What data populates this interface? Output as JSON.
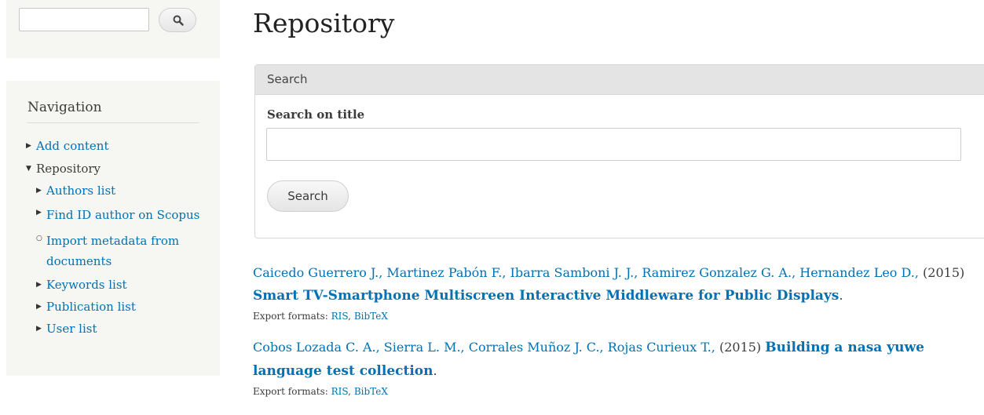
{
  "sidebar": {
    "search": {
      "value": "",
      "button_icon": "search-icon"
    },
    "navigation": {
      "title": "Navigation",
      "items": [
        {
          "label": "Add content",
          "state": "collapsed"
        },
        {
          "label": "Repository",
          "state": "expanded",
          "children": [
            {
              "label": "Authors list"
            },
            {
              "label": "Find ID author on Scopus"
            },
            {
              "label": "Import metadata from documents"
            },
            {
              "label": "Keywords list"
            },
            {
              "label": "Publication list"
            },
            {
              "label": "User list"
            }
          ]
        }
      ]
    }
  },
  "main": {
    "page_title": "Repository",
    "search_form": {
      "legend": "Search",
      "field_label": "Search on title",
      "field_value": "",
      "submit_label": "Search"
    },
    "results": [
      {
        "authors": "Caicedo Guerrero J., Martinez Pabón F., Ibarra Samboni J. J., Ramirez Gonzalez G. A., Hernandez Leo D.,",
        "year": "(2015)",
        "title": "Smart TV-Smartphone Multiscreen Interactive Middleware for Public Displays",
        "period": ".",
        "export_label": "Export formats:",
        "export_ris": "RIS",
        "export_sep": ",",
        "export_bibtex": "BibTeX"
      },
      {
        "authors": "Cobos Lozada C. A., Sierra L. M., Corrales Muñoz J. C., Rojas Curieux T.,",
        "year": "(2015)",
        "title": "Building a nasa yuwe language test collection",
        "period": ".",
        "export_label": "Export formats:",
        "export_ris": "RIS",
        "export_sep": ",",
        "export_bibtex": "BibTeX"
      }
    ]
  },
  "colors": {
    "link": "#0071b3",
    "sidebar_bg": "#f6f6f2",
    "legend_bg": "#e4e4e4"
  }
}
